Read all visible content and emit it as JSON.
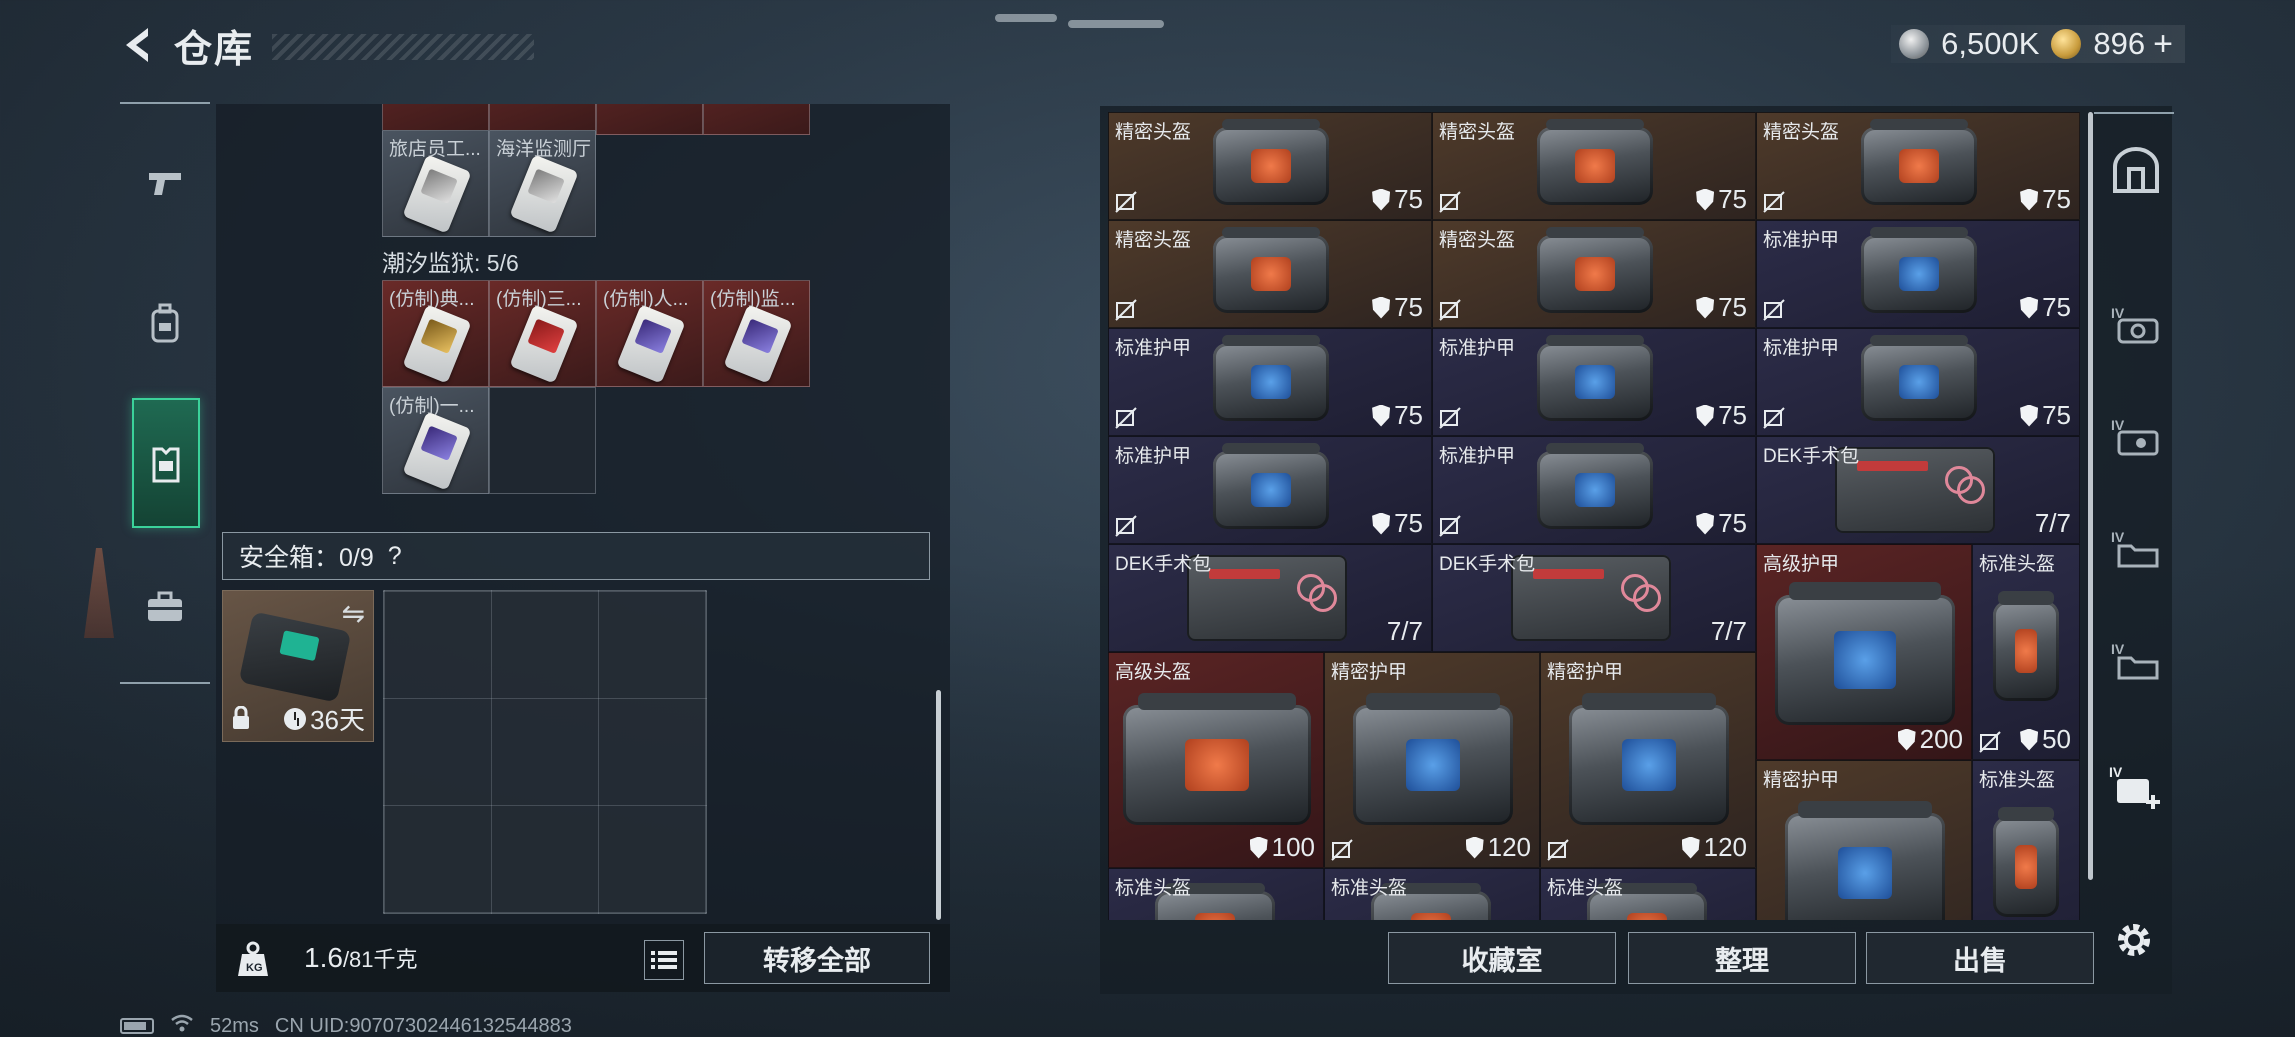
{
  "header": {
    "title": "仓库"
  },
  "currency": {
    "silver": "6,500K",
    "gold": "896"
  },
  "left_nav": [
    {
      "icon": "pistol-icon"
    },
    {
      "icon": "backpack-icon"
    },
    {
      "icon": "vest-icon"
    },
    {
      "icon": "briefcase-icon"
    }
  ],
  "keys_top_row": [
    {
      "name": "旅店员工..."
    },
    {
      "name": "海洋监测厅"
    }
  ],
  "prison": {
    "label": "潮汐监狱: 5/6",
    "keys": [
      {
        "name": "(仿制)典..."
      },
      {
        "name": "(仿制)三..."
      },
      {
        "name": "(仿制)人..."
      },
      {
        "name": "(仿制)监..."
      },
      {
        "name": "(仿制)一..."
      }
    ]
  },
  "safe": {
    "label": "安全箱：0/9",
    "help": "?",
    "days": "36天"
  },
  "left_bottom": {
    "weight": "1.6",
    "weight_max": "/81千克",
    "transfer": "转移全部"
  },
  "status_bar": {
    "ping": "52ms",
    "uid": "CN UID:90707302446132544883"
  },
  "items": [
    {
      "name": "精密头盔",
      "value": "75"
    },
    {
      "name": "精密头盔",
      "value": "75"
    },
    {
      "name": "精密头盔",
      "value": "75"
    },
    {
      "name": "精密头盔",
      "value": "75"
    },
    {
      "name": "精密头盔",
      "value": "75"
    },
    {
      "name": "标准护甲",
      "value": "75"
    },
    {
      "name": "标准护甲",
      "value": "75"
    },
    {
      "name": "标准护甲",
      "value": "75"
    },
    {
      "name": "标准护甲",
      "value": "75"
    },
    {
      "name": "标准护甲",
      "value": "75"
    },
    {
      "name": "标准护甲",
      "value": "75"
    },
    {
      "name": "DEK手术包",
      "value": "7/7"
    },
    {
      "name": "DEK手术包",
      "value": "7/7"
    },
    {
      "name": "DEK手术包",
      "value": "7/7"
    },
    {
      "name": "高级护甲",
      "value": "200"
    },
    {
      "name": "标准头盔",
      "value": "50"
    },
    {
      "name": "高级头盔",
      "value": "100"
    },
    {
      "name": "精密护甲",
      "value": "120"
    },
    {
      "name": "精密护甲",
      "value": "120"
    },
    {
      "name": "精密护甲",
      "value": ""
    },
    {
      "name": "标准头盔",
      "value": ""
    },
    {
      "name": "标准头盔",
      "value": ""
    },
    {
      "name": "标准头盔",
      "value": ""
    },
    {
      "name": "标准头盔",
      "value": ""
    }
  ],
  "right_bottom": {
    "collection": "收藏室",
    "sort": "整理",
    "sell": "出售"
  },
  "right_nav": [
    "locker-icon",
    "mask-iv-icon",
    "camera-iv-icon",
    "folder-iv-icon",
    "folder-iv-icon-2",
    "add-iv-icon"
  ],
  "colors": {
    "accent": "#3bd29a",
    "brown": "#4e3a2a",
    "navy": "#2c2c48",
    "maroon": "#5a2424"
  }
}
